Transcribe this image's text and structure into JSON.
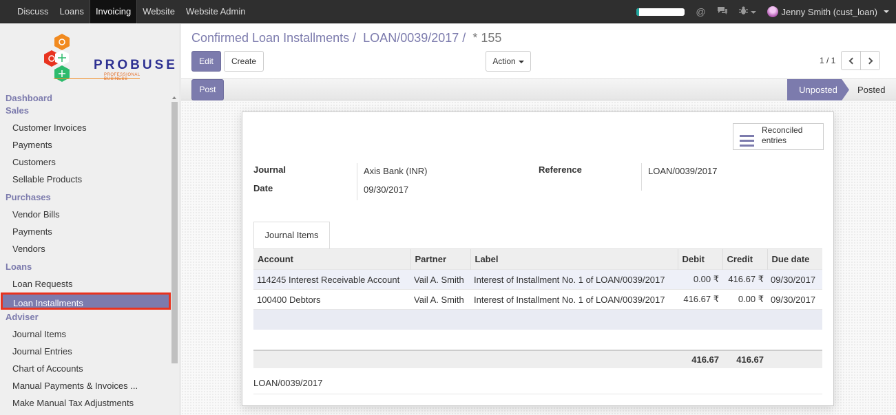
{
  "topbar": {
    "menu": [
      "Discuss",
      "Loans",
      "Invoicing",
      "Website",
      "Website Admin"
    ],
    "active_index": 2,
    "progress": 0.05,
    "user_name": "Jenny Smith (cust_loan)",
    "icons": [
      "at-icon",
      "chat-icon",
      "bug-icon"
    ]
  },
  "sidebar": {
    "logo_text": "PROBUSE",
    "logo_sub": "PROFESSIONAL BUSINESS",
    "sections": [
      {
        "title": "Dashboard",
        "items": []
      },
      {
        "title": "Sales",
        "items": [
          "Customer Invoices",
          "Payments",
          "Customers",
          "Sellable Products"
        ]
      },
      {
        "title": "Purchases",
        "items": [
          "Vendor Bills",
          "Payments",
          "Vendors"
        ]
      },
      {
        "title": "Loans",
        "items": [
          "Loan Requests",
          "Loan Installments"
        ]
      },
      {
        "title": "Adviser",
        "items": [
          "Journal Items",
          "Journal Entries",
          "Chart of Accounts",
          "Manual Payments & Invoices ...",
          "Make Manual Tax Adjustments"
        ]
      }
    ],
    "selected": "Loan Installments"
  },
  "breadcrumb": {
    "part1": "Confirmed Loan Installments",
    "part2": "LOAN/0039/2017",
    "current": "* 155",
    "sep": "/"
  },
  "toolbar": {
    "edit": "Edit",
    "create": "Create",
    "action": "Action",
    "pager": "1 / 1"
  },
  "status": {
    "post_button": "Post",
    "stages": [
      "Unposted",
      "Posted"
    ],
    "current_stage": "Unposted"
  },
  "form": {
    "reconciled_label": "Reconciled entries",
    "journal_label": "Journal",
    "journal_value": "Axis Bank (INR)",
    "date_label": "Date",
    "date_value": "09/30/2017",
    "reference_label": "Reference",
    "reference_value": "LOAN/0039/2017",
    "tab": "Journal Items",
    "columns": [
      "Account",
      "Partner",
      "Label",
      "Debit",
      "Credit",
      "Due date"
    ],
    "rows": [
      {
        "account": "114245 Interest Receivable Account",
        "partner": "Vail A. Smith",
        "label": "Interest of Installment No. 1 of LOAN/0039/2017",
        "debit": "0.00 ₹",
        "credit": "416.67 ₹",
        "due": "09/30/2017"
      },
      {
        "account": "100400 Debtors",
        "partner": "Vail A. Smith",
        "label": "Interest of Installment No. 1 of LOAN/0039/2017",
        "debit": "416.67 ₹",
        "credit": "0.00 ₹",
        "due": "09/30/2017"
      }
    ],
    "total_debit": "416.67",
    "total_credit": "416.67",
    "footer_ref": "LOAN/0039/2017"
  },
  "colors": {
    "accent": "#7c7bad",
    "highlight_border": "#e8331f",
    "topbar": "#2f2f2f"
  }
}
